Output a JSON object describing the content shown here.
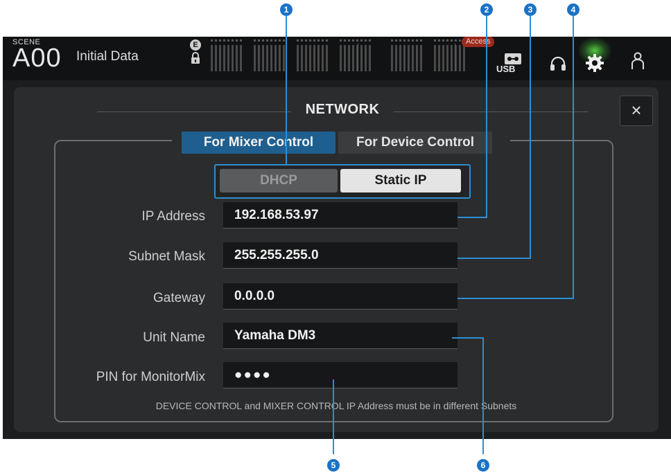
{
  "header": {
    "scene_label": "SCENE",
    "scene_number": "A00",
    "scene_name": "Initial Data",
    "e_badge": "E",
    "access_badge": "Access",
    "usb_label": "USB",
    "icons": [
      "lock-icon",
      "usb-icon",
      "headphone-icon",
      "gear-icon",
      "user-icon"
    ]
  },
  "dialog": {
    "title": "NETWORK",
    "close_label": "×",
    "tabs": [
      {
        "label": "For Mixer Control",
        "active": true
      },
      {
        "label": "For Device Control",
        "active": false
      }
    ],
    "mode": {
      "options": [
        "DHCP",
        "Static IP"
      ],
      "selected": "Static IP"
    },
    "fields": [
      {
        "label": "IP Address",
        "value": "192.168.53.97"
      },
      {
        "label": "Subnet Mask",
        "value": "255.255.255.0"
      },
      {
        "label": "Gateway",
        "value": "0.0.0.0"
      },
      {
        "label": "Unit Name",
        "value": "Yamaha DM3"
      },
      {
        "label": "PIN for MonitorMix",
        "value": "●●●●"
      }
    ],
    "note": "DEVICE CONTROL and MIXER CONTROL IP Address must be in different Subnets"
  },
  "callouts": [
    "1",
    "2",
    "3",
    "4",
    "5",
    "6"
  ],
  "colors": {
    "accent_blue": "#1f5f8f",
    "callout_blue": "#1a72c6",
    "access_red": "#9b2a1d",
    "gear_glow": "#5adc46"
  }
}
